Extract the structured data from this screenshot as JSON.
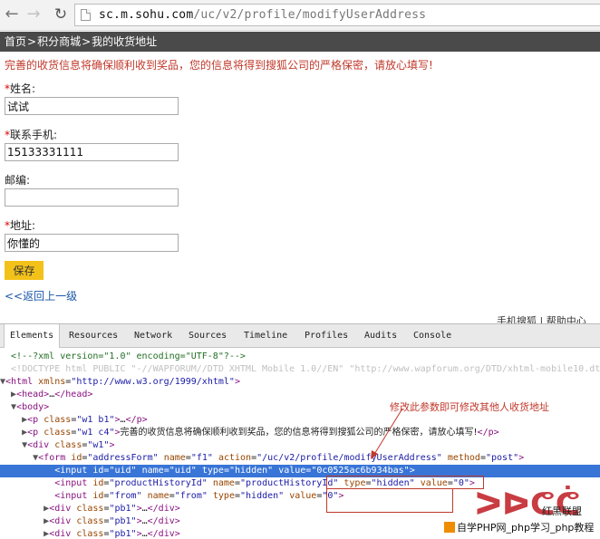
{
  "browser": {
    "url_host": "sc.m.sohu.com",
    "url_path": "/uc/v2/profile/modifyUserAddress"
  },
  "page": {
    "breadcrumb": [
      "首页",
      "积分商城",
      "我的收货地址"
    ],
    "breadcrumb_sep": ">",
    "notice": "完善的收货信息将确保顺利收到奖品，您的信息将得到搜狐公司的严格保密，请放心填写!",
    "fields": [
      {
        "star": "*",
        "label": "姓名:",
        "value": "试试"
      },
      {
        "star": "*",
        "label": "联系手机:",
        "value": "15133331111"
      },
      {
        "star": "",
        "label": "邮编:",
        "value": ""
      },
      {
        "star": "*",
        "label": "地址:",
        "value": "你懂的"
      }
    ],
    "save_label": "保存",
    "back_link": "<<返回上一级",
    "partial_links": "手机搜狐 | 帮助中心"
  },
  "devtools": {
    "tabs": [
      "Elements",
      "Resources",
      "Network",
      "Sources",
      "Timeline",
      "Profiles",
      "Audits",
      "Console"
    ],
    "active_tab": "Elements",
    "annotation": "修改此参数即可修改其他人收货地址",
    "annotation_color": "#c0392b",
    "selection_color": "#3875d7"
  },
  "watermark": {
    "cn_logo": "红黑联盟",
    "bar_text": "自学PHP网_php学习_php教程"
  }
}
